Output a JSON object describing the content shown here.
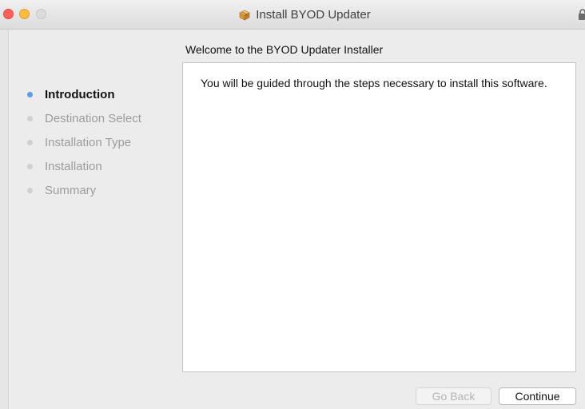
{
  "window": {
    "title": "Install BYOD Updater",
    "title_icon": "package-icon"
  },
  "header": {
    "subtitle": "Welcome to the BYOD Updater Installer"
  },
  "sidebar": {
    "steps": [
      {
        "label": "Introduction",
        "active": true
      },
      {
        "label": "Destination Select",
        "active": false
      },
      {
        "label": "Installation Type",
        "active": false
      },
      {
        "label": "Installation",
        "active": false
      },
      {
        "label": "Summary",
        "active": false
      }
    ]
  },
  "main": {
    "body_text": "You will be guided through the steps necessary to install this software."
  },
  "footer": {
    "back_label": "Go Back",
    "back_enabled": false,
    "continue_label": "Continue"
  },
  "colors": {
    "active_step_dot": "#5b9ee6",
    "inactive_step_dot": "#d0d0d0",
    "close": "#fc605b",
    "minimize": "#fdbc40"
  }
}
